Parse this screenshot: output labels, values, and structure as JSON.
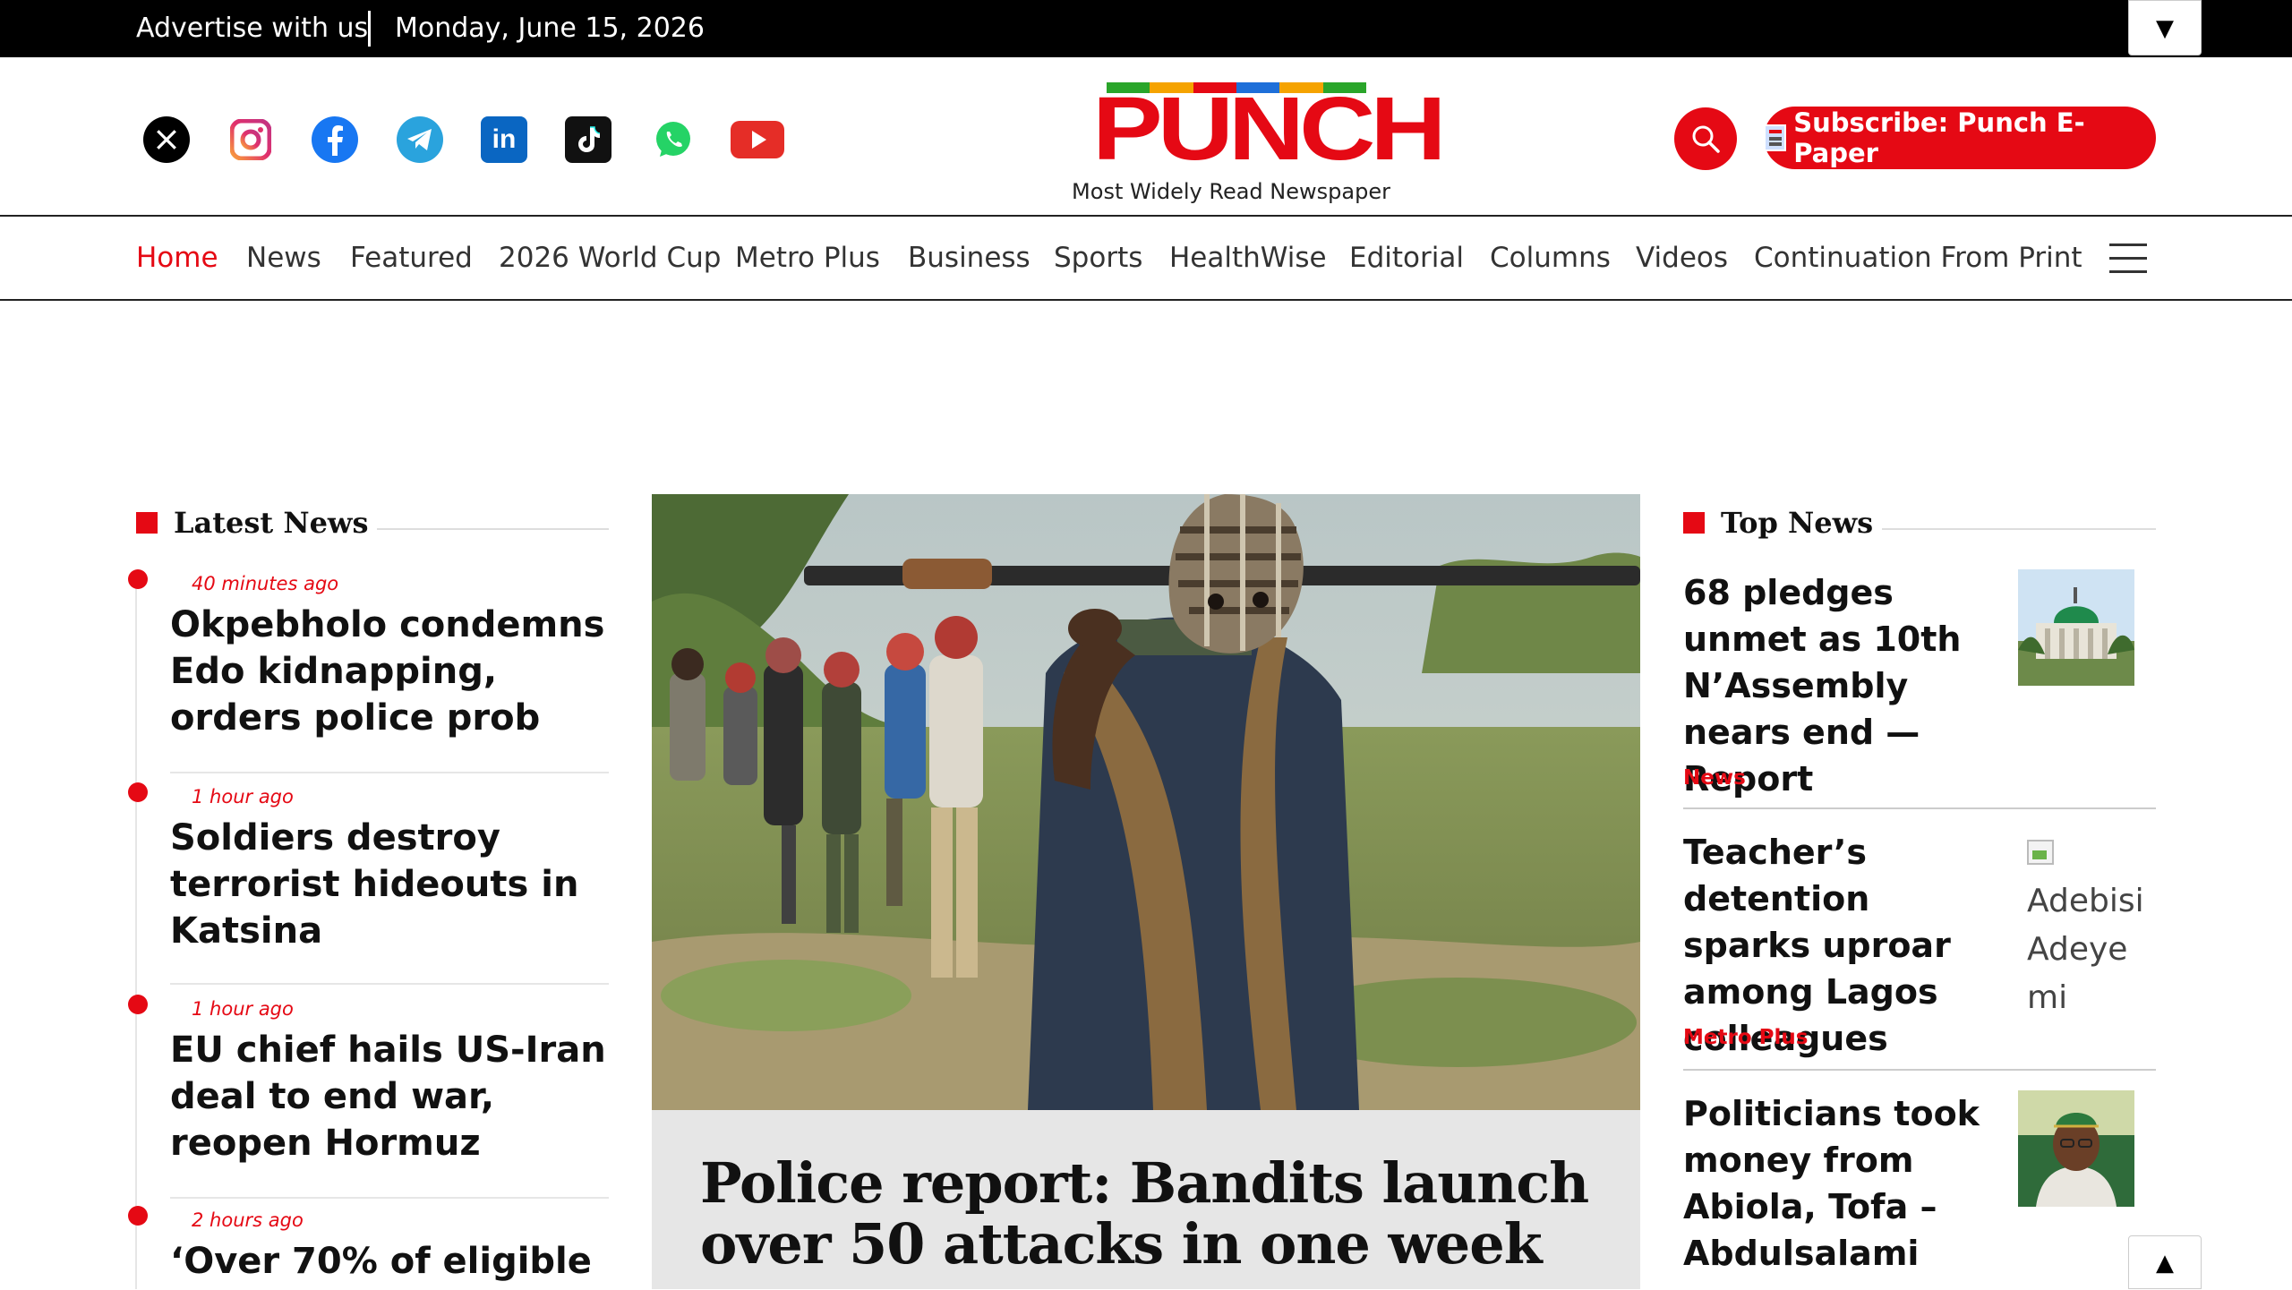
{
  "topbar": {
    "advertise": "Advertise with us",
    "date": "Monday, June 15, 2026",
    "dropdown_icon": "▼"
  },
  "social": [
    {
      "name": "x-icon",
      "glyph": "𝕏",
      "color": "#000000"
    },
    {
      "name": "instagram-icon",
      "color": "#e1306c"
    },
    {
      "name": "facebook-icon",
      "glyph": "f",
      "color": "#1877f2"
    },
    {
      "name": "telegram-icon",
      "color": "#2aa3dd"
    },
    {
      "name": "linkedin-icon",
      "glyph": "in",
      "color": "#0a66c2"
    },
    {
      "name": "tiktok-icon",
      "glyph": "♪",
      "color": "#111111"
    },
    {
      "name": "whatsapp-icon",
      "color": "#25d366"
    },
    {
      "name": "youtube-icon",
      "color": "#e52d27"
    }
  ],
  "logo": {
    "text": "PUNCH",
    "tagline": "Most Widely Read Newspaper",
    "color": "#e50914",
    "bar_colors": [
      "#2aa52a",
      "#f5a300",
      "#e50914",
      "#1e6fd9"
    ]
  },
  "header": {
    "subscribe_label": "Subscribe: Punch E-Paper",
    "accent": "#e50914"
  },
  "nav": {
    "items": [
      "Home",
      "News",
      "Featured",
      "2026 World Cup",
      "Metro Plus",
      "Business",
      "Sports",
      "HealthWise",
      "Editorial",
      "Columns",
      "Videos",
      "Continuation From Print"
    ],
    "active": "Home"
  },
  "latest": {
    "heading": "Latest News",
    "items": [
      {
        "time": "40 minutes ago",
        "title": "Okpebholo condemns Edo kidnapping, orders police prob"
      },
      {
        "time": "1 hour ago",
        "title": "Soldiers destroy terrorist hideouts in Katsina"
      },
      {
        "time": "1 hour ago",
        "title": "EU chief hails US-Iran deal to end war, reopen Hormuz"
      },
      {
        "time": "2 hours ago",
        "title": "‘Over 70% of eligible"
      }
    ]
  },
  "hero": {
    "title": "Police report: Bandits launch over 50 attacks in one week"
  },
  "top": {
    "heading": "Top News",
    "items": [
      {
        "title": "68 pledges unmet as 10th N’Assembly nears end — Report",
        "category": "News"
      },
      {
        "title": "Teacher’s detention sparks uproar among Lagos colleagues",
        "category": "Metro Plus",
        "broken_alt": "Adebisi Adeyemi"
      },
      {
        "title": "Politicians took money from Abiola, Tofa – Abdulsalami",
        "category": ""
      }
    ]
  },
  "scroll_top_icon": "▲"
}
